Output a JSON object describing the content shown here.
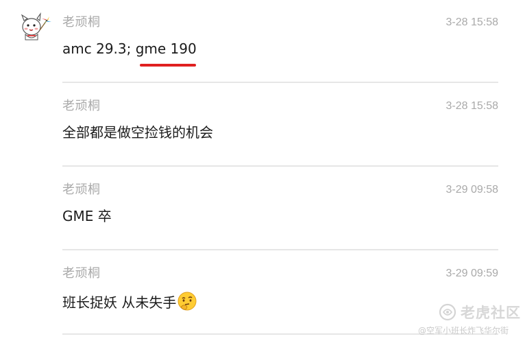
{
  "colors": {
    "author": "#a9a9a9",
    "timestamp": "#a9a9a9",
    "content": "#1b1b1b",
    "divider": "#e6e6e6",
    "highlight_underline": "#e02020",
    "watermark": "#d7d7d7"
  },
  "messages": [
    {
      "author": "老顽桐",
      "time": "3-28 15:58",
      "text": "amc 29.3; gme 190",
      "annotation": "red-underline"
    },
    {
      "author": "老顽桐",
      "time": "3-28 15:58",
      "text": "全部都是做空捡钱的机会"
    },
    {
      "author": "老顽桐",
      "time": "3-29 09:58",
      "text": "GME 卒"
    },
    {
      "author": "老顽桐",
      "time": "3-29 09:59",
      "text": "班长捉妖 从未失手",
      "emoji": "thinking-face-icon"
    }
  ],
  "avatar": {
    "icon": "cartoon-avatar-icon"
  },
  "watermark": {
    "logo": "tiger-logo-icon",
    "title": "老虎社区",
    "subtitle": "@空军小班长炸飞华尔街"
  }
}
